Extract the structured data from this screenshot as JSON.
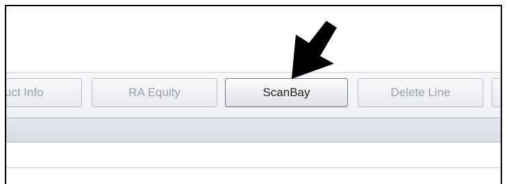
{
  "toolbar": {
    "buttons": [
      {
        "label": "luct Info",
        "state": "disabled"
      },
      {
        "label": "RA Equity",
        "state": "disabled"
      },
      {
        "label": "ScanBay",
        "state": "enabled"
      },
      {
        "label": "Delete Line",
        "state": "disabled"
      },
      {
        "label": "",
        "state": "disabled"
      }
    ]
  },
  "colors": {
    "frame": "#000000",
    "disabled_text": "#9aa1a9",
    "enabled_text": "#1e1e1e",
    "arrow": "#000000"
  },
  "icons": {
    "pointer": "callout-arrow-icon"
  }
}
